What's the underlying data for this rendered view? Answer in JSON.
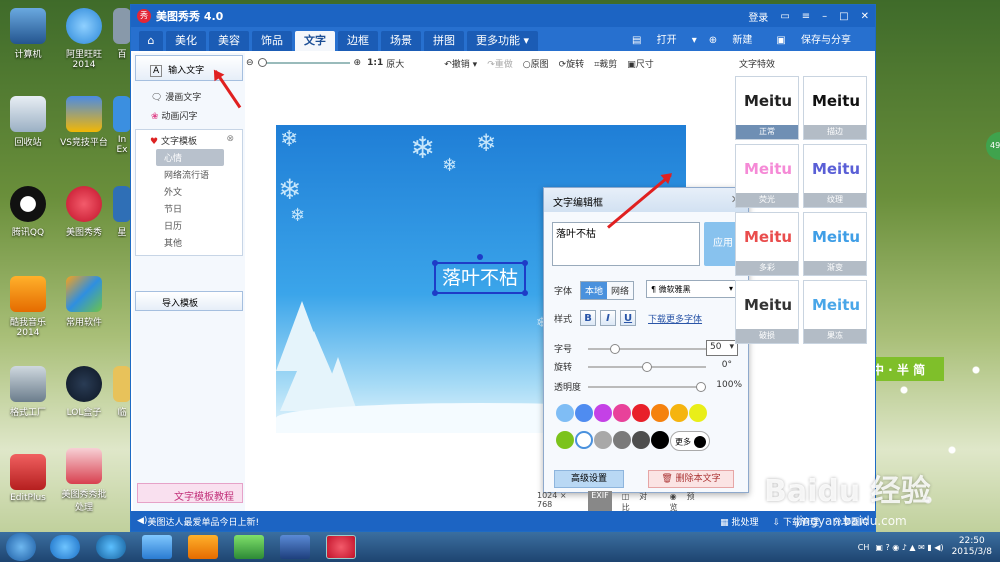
{
  "desktop": {
    "icons_left": [
      "计算机",
      "回收站",
      "腾讯QQ",
      "酷我音乐\n2014",
      "格式工厂",
      "EditPlus"
    ],
    "icons_col2": [
      "阿里旺旺\n2014",
      "VS竞技平台",
      "美图秀秀",
      "常用软件",
      "LOL盒子",
      "美图秀秀批\n处理"
    ],
    "partial_col3": [
      "百",
      "In\nEx",
      "星",
      "",
      "临",
      ""
    ],
    "ime_label": "中 · 半 简",
    "badge": "49"
  },
  "window": {
    "logo": "秀",
    "title": "美图秀秀 4.0",
    "login": "登录",
    "tabs": [
      "美化",
      "美容",
      "饰品",
      "文字",
      "边框",
      "场景",
      "拼图",
      "更多功能 ▾"
    ],
    "active_tab": "文字",
    "open": "打开",
    "new": "新建",
    "save_share": "保存与分享"
  },
  "toolbar": {
    "ratio": "1:1",
    "original_size": "原大",
    "undo": "撤销",
    "redo": "重做",
    "original_image": "原图",
    "rotate": "旋转",
    "crop": "裁剪",
    "size": "尺寸"
  },
  "leftpanel": {
    "input_text": "输入文字",
    "comic_text": "漫画文字",
    "animated_text": "动画闪字",
    "template_header": "文字模板",
    "templates": [
      "心情",
      "网络流行语",
      "外文",
      "节日",
      "日历",
      "其他"
    ],
    "selected_template": "心情",
    "import_template": "导入模板",
    "tutorial": "文字模板教程"
  },
  "canvas": {
    "text": "落叶不枯"
  },
  "editor": {
    "title": "文字编辑框",
    "input_value": "落叶不枯",
    "apply": "应用",
    "font_label": "字体",
    "font_local": "本地",
    "font_network": "网络",
    "font_value": "微软雅黑",
    "style_label": "样式",
    "bold": "B",
    "italic": "I",
    "underline": "U",
    "download_fonts": "下载更多字体",
    "size_label": "字号",
    "size_value": "50",
    "size_level": 0.2,
    "rotate_label": "旋转",
    "rotate_value": "0°",
    "rotate_level": 0.5,
    "opacity_label": "透明度",
    "opacity_value": "100%",
    "opacity_level": 1.0,
    "colors_row1": [
      "#7fbdf5",
      "#4f8cf0",
      "#c441e6",
      "#e8429a",
      "#e8202a",
      "#f5820f",
      "#f5b40f",
      "#e9ee19"
    ],
    "colors_row2": [
      "#7cc31c",
      "#ffffff",
      "#a8a8a8",
      "#7a7a7a",
      "#4e4e4e",
      "#000000"
    ],
    "more": "更多",
    "advanced": "高级设置",
    "delete": "删除本文字"
  },
  "effects": {
    "header": "文字特效",
    "items": [
      {
        "sample": "Meitu",
        "caption": "正常",
        "color": "#222222"
      },
      {
        "sample": "Meitu",
        "caption": "描边",
        "color": "#111111"
      },
      {
        "sample": "Meitu",
        "caption": "荧光",
        "color": "#f58ad6"
      },
      {
        "sample": "Meitu",
        "caption": "纹理",
        "color": "#5a5fd6"
      },
      {
        "sample": "Meitu",
        "caption": "多彩",
        "color": "#e94d4d"
      },
      {
        "sample": "Meitu",
        "caption": "渐变",
        "color": "#3f9ee6"
      },
      {
        "sample": "Meitu",
        "caption": "破损",
        "color": "#333333"
      },
      {
        "sample": "Meitu",
        "caption": "果冻",
        "color": "#49a6e8"
      }
    ]
  },
  "status": {
    "dimensions": "1024 × 768",
    "exif": "EXIF",
    "compare": "对比",
    "preview": "预览",
    "news": "美图达人最爱单品今日上新!",
    "batch": "批处理",
    "download_manager": "下载管理",
    "share": "分享图片"
  },
  "taskbar": {
    "ime": "CH",
    "time": "22:50",
    "date": "2015/3/8"
  },
  "watermark": {
    "brand": "Baidu 经验",
    "url": "jingyan.baidu.com"
  }
}
